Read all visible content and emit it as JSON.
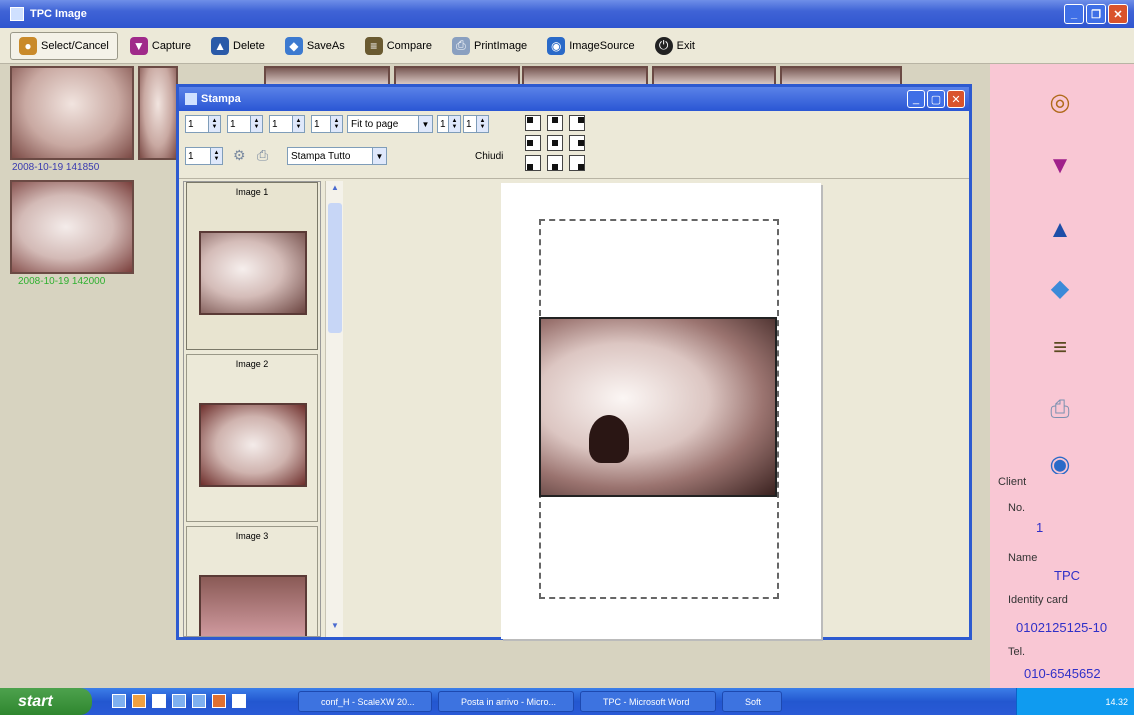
{
  "window": {
    "title": "TPC Image"
  },
  "toolbar": {
    "items": [
      {
        "label": "Select/Cancel",
        "icon": "select-icon"
      },
      {
        "label": "Capture",
        "icon": "capture-icon"
      },
      {
        "label": "Delete",
        "icon": "delete-icon"
      },
      {
        "label": "SaveAs",
        "icon": "saveas-icon"
      },
      {
        "label": "Compare",
        "icon": "compare-icon"
      },
      {
        "label": "PrintImage",
        "icon": "print-icon"
      },
      {
        "label": "ImageSource",
        "icon": "imagesource-icon"
      },
      {
        "label": "Exit",
        "icon": "exit-icon"
      }
    ]
  },
  "gallery": {
    "caption1": "2008-10-19 141850",
    "caption2": "2008-10-19 142000"
  },
  "dialog": {
    "title": "Stampa",
    "spin1": "1",
    "spin2": "1",
    "spin3": "1",
    "spin4": "1",
    "fit_option": "Fit to page",
    "spin5": "1",
    "spin6": "1",
    "spin7": "1",
    "print_mode": "Stampa Tutto",
    "close_label": "Chiudi",
    "images": [
      {
        "label": "Image 1"
      },
      {
        "label": "Image 2"
      },
      {
        "label": "Image 3"
      }
    ]
  },
  "client": {
    "section": "Client",
    "no_label": "No.",
    "no_value": "1",
    "name_label": "Name",
    "name_value": "TPC",
    "id_label": "Identity card",
    "id_value": "0102125125-10",
    "tel_label": "Tel.",
    "tel_value": "010-6545652"
  },
  "taskbar": {
    "start": "start",
    "tasks": [
      "conf_H - ScaleXW 20...",
      "Posta in arrivo - Micro...",
      "TPC - Microsoft Word",
      "Soft"
    ],
    "clock": "14.32"
  }
}
